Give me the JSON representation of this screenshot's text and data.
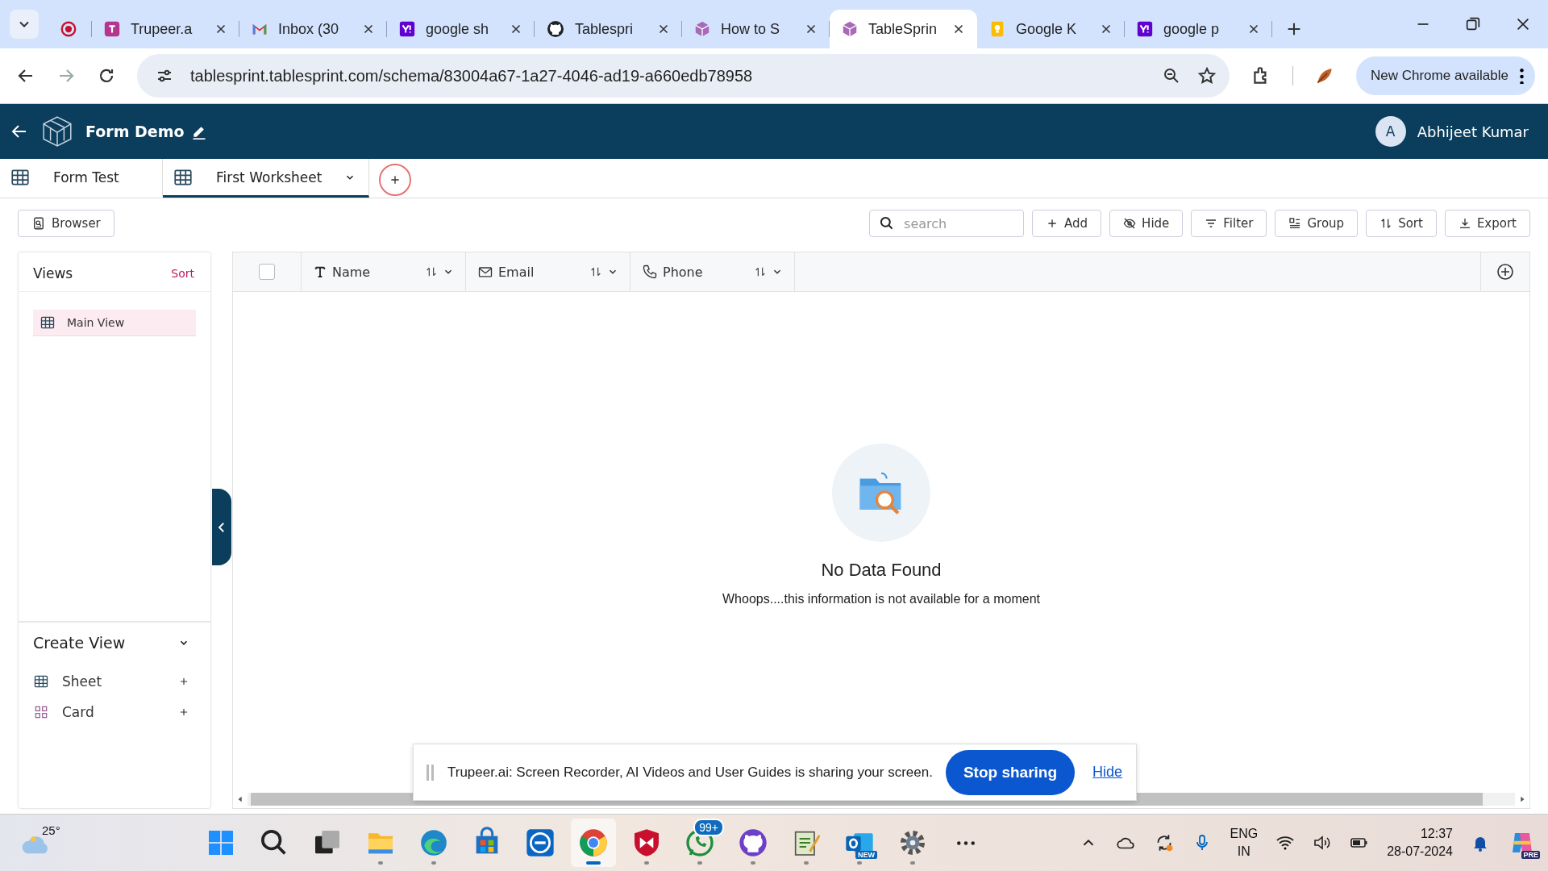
{
  "browser": {
    "tabs": [
      {
        "kind": "record",
        "selected": false
      },
      {
        "kind": "trupeer",
        "title": "Trupeer.a",
        "selected": false
      },
      {
        "kind": "mail",
        "title": "Inbox (30",
        "selected": false
      },
      {
        "kind": "yahoo",
        "title": "google sh",
        "selected": false
      },
      {
        "kind": "github",
        "title": "Tablespri",
        "selected": false
      },
      {
        "kind": "cube",
        "title": "How to S",
        "selected": false
      },
      {
        "kind": "cube",
        "title": "TableSprin",
        "selected": true
      },
      {
        "kind": "keep",
        "title": "Google K",
        "selected": false
      },
      {
        "kind": "yahoo",
        "title": "google p",
        "selected": false
      }
    ],
    "url": "tablesprint.tablesprint.com/schema/83004a67-1a27-4046-ad19-a660edb78958",
    "update_button": "New Chrome available"
  },
  "app": {
    "title": "Form Demo",
    "user": {
      "initial": "A",
      "name": "Abhijeet Kumar"
    }
  },
  "sheets": [
    {
      "label": "Form Test",
      "selected": false
    },
    {
      "label": "First Worksheet",
      "selected": true
    }
  ],
  "toolbar": {
    "browser_button": "Browser",
    "search": {
      "placeholder": "search"
    },
    "buttons": [
      {
        "kind": "add",
        "label": "Add"
      },
      {
        "kind": "hide",
        "label": "Hide"
      },
      {
        "kind": "filter",
        "label": "Filter"
      },
      {
        "kind": "group",
        "label": "Group"
      },
      {
        "kind": "sort",
        "label": "Sort"
      },
      {
        "kind": "export",
        "label": "Export"
      }
    ]
  },
  "views": {
    "title": "Views",
    "sort_link": "Sort",
    "items": [
      {
        "label": "Main View",
        "selected": true
      }
    ],
    "create_view": {
      "title": "Create View",
      "expanded": true,
      "items": [
        {
          "kind": "sheet",
          "label": "Sheet"
        },
        {
          "kind": "card",
          "label": "Card"
        }
      ]
    }
  },
  "grid": {
    "select_all": {
      "checked": false
    },
    "columns": [
      {
        "kind": "text",
        "label": "Name"
      },
      {
        "kind": "email",
        "label": "Email"
      },
      {
        "kind": "phone",
        "label": "Phone"
      }
    ],
    "empty": {
      "title": "No Data Found",
      "message": "Whoops....this information is not available for a moment"
    }
  },
  "share_bar": {
    "message": "Trupeer.ai: Screen Recorder, AI Videos and User Guides is sharing your screen.",
    "stop_button": "Stop sharing",
    "hide_link": "Hide"
  },
  "taskbar": {
    "weather": "25°",
    "apps": [
      {
        "kind": "start",
        "running": false,
        "selected": false
      },
      {
        "kind": "search",
        "running": false,
        "selected": false
      },
      {
        "kind": "taskview",
        "running": false,
        "selected": false
      },
      {
        "kind": "folder",
        "running": true,
        "selected": false
      },
      {
        "kind": "edge",
        "running": true,
        "selected": false
      },
      {
        "kind": "store",
        "running": false,
        "selected": false
      },
      {
        "kind": "dell",
        "running": false,
        "selected": false
      },
      {
        "kind": "chrome",
        "running": true,
        "selected": true
      },
      {
        "kind": "shield",
        "running": true,
        "selected": false
      },
      {
        "kind": "whatsapp",
        "running": true,
        "selected": false,
        "badge": "99+"
      },
      {
        "kind": "github",
        "running": true,
        "selected": false
      },
      {
        "kind": "notepad",
        "running": true,
        "selected": false
      },
      {
        "kind": "outlook",
        "running": true,
        "selected": false,
        "badge": "NEW"
      },
      {
        "kind": "settings",
        "running": true,
        "selected": false
      },
      {
        "kind": "more",
        "running": false,
        "selected": false
      }
    ],
    "language": "ENG",
    "region": "IN",
    "time": "12:37",
    "date": "28-07-2024",
    "copilot_badge": "PRE"
  }
}
